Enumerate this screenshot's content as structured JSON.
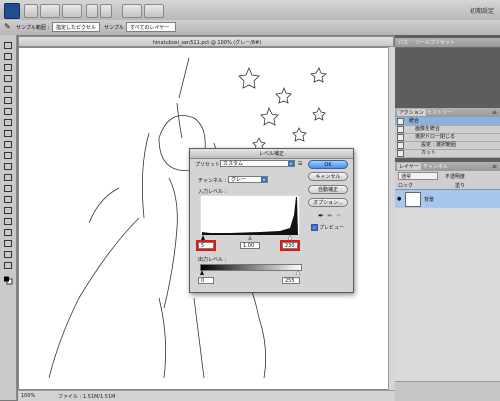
{
  "app_bar": {
    "workspace": "初期設定"
  },
  "options_bar": {
    "sample_size_label": "サンプル範囲 :",
    "sample_size_value": "指定したピクセル",
    "sample_label": "サンプル :",
    "sample_value": "すべてのレイヤー"
  },
  "document": {
    "title": "hinatubosi_sen511.pct @ 100% (グレー/8#)",
    "zoom": "100%",
    "file_size": "ファイル : 1.51M/1.51M"
  },
  "panels": {
    "top_tabs": [
      "パス",
      "ツールプリセット"
    ],
    "actions_tabs": [
      "アクション",
      "ヒストリー"
    ],
    "actions": [
      {
        "label": "統合"
      },
      {
        "label": "画像を統合"
      },
      {
        "label": "選択ドロー閉じる"
      },
      {
        "label": "設定 : 選択範囲"
      },
      {
        "label": "カット"
      }
    ],
    "layers_tabs": [
      "レイヤー",
      "チャンネル"
    ],
    "blend_mode": "通常",
    "opacity_label": "不透明度",
    "lock_label": "ロック",
    "fill_label": "塗り",
    "layer_name": "背景"
  },
  "levels_dialog": {
    "title": "レベル補正",
    "preset_label": "プリセット :",
    "preset_value": "カスタム",
    "channel_label": "チャンネル :",
    "channel_value": "グレー",
    "input_levels_label": "入力レベル :",
    "input_black": "5",
    "input_gamma": "1.00",
    "input_white": "230",
    "output_levels_label": "出力レベル :",
    "output_black": "0",
    "output_white": "255",
    "ok_label": "OK",
    "cancel_label": "キャンセル",
    "auto_label": "自動補正",
    "options_label": "オプション...",
    "preview_label": "プレビュー",
    "preview_checked": true
  }
}
